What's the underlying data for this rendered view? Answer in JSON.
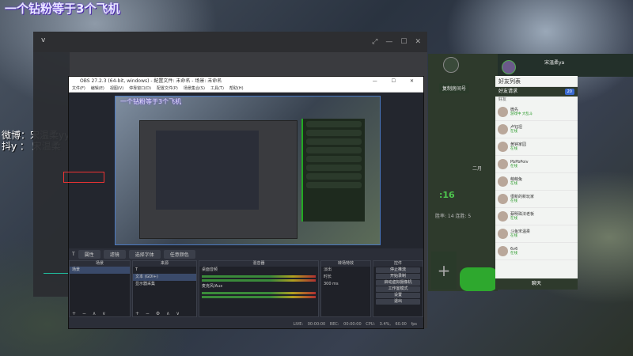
{
  "overlay": {
    "title": "一个钻粉等于3个飞机",
    "weibo": "微博：宋温柔yyds",
    "douyin": "抖y ： 宋温柔"
  },
  "obs": {
    "title": "OBS 27.2.3 (64-bit, windows) - 配置文件: 未命名 - 场景: 未命名",
    "menu": [
      "文件(F)",
      "编辑(E)",
      "视图(V)",
      "停靠窗口(D)",
      "配置文件(P)",
      "场景集合(S)",
      "工具(T)",
      "帮助(H)"
    ],
    "scenebar": {
      "item": "T",
      "props": "属性",
      "filters": "滤镜",
      "btn1": "选择字体",
      "btn2": "任意颜色"
    },
    "docks": {
      "scenes": {
        "header": "场景",
        "items": [
          "场景"
        ]
      },
      "sources": {
        "header": "来源",
        "items": [
          "T",
          "文本 (GDI+)",
          "显示器采集"
        ]
      },
      "mixer": {
        "header": "混音器",
        "ch1": "桌面音频",
        "ch2": "麦克风/Aux"
      },
      "transitions": {
        "header": "转场特效",
        "fade": "淡出",
        "duration_label": "时长",
        "duration": "300 ms"
      },
      "controls": {
        "header": "控件",
        "buttons": [
          "停止推流",
          "开始录制",
          "启动虚拟摄像机",
          "工作室模式",
          "设置",
          "退出"
        ]
      }
    },
    "status": "LIVE: 00:00:00   REC: 00:00:00   CPU: 3.4%, 60.00 fps"
  },
  "client": {
    "copy_account": "复制房间号",
    "month": "二月",
    "big_number": ":16",
    "stats": "胜率: 14    连胜: 5"
  },
  "friends": {
    "self_name": "宋温柔ya",
    "header": "好友列表",
    "requests_label": "好友请求",
    "requests_count": "20",
    "group": "好友",
    "list": [
      {
        "name": "微先",
        "status": "游戏中 大乱斗"
      },
      {
        "name": "卢钰坦",
        "status": "在线"
      },
      {
        "name": "黄钟家园",
        "status": "在线"
      },
      {
        "name": "PbPbPoiv",
        "status": "在线"
      },
      {
        "name": "萌萌兔",
        "status": "在线"
      },
      {
        "name": "很新的新玩家",
        "status": "在线"
      },
      {
        "name": "蔡明珠法老板",
        "status": "在线"
      },
      {
        "name": "斗鱼宋温柔",
        "status": "在线"
      },
      {
        "name": "6v6",
        "status": "在线"
      }
    ],
    "footer": "聊天"
  },
  "window": {
    "chevron": "v"
  }
}
